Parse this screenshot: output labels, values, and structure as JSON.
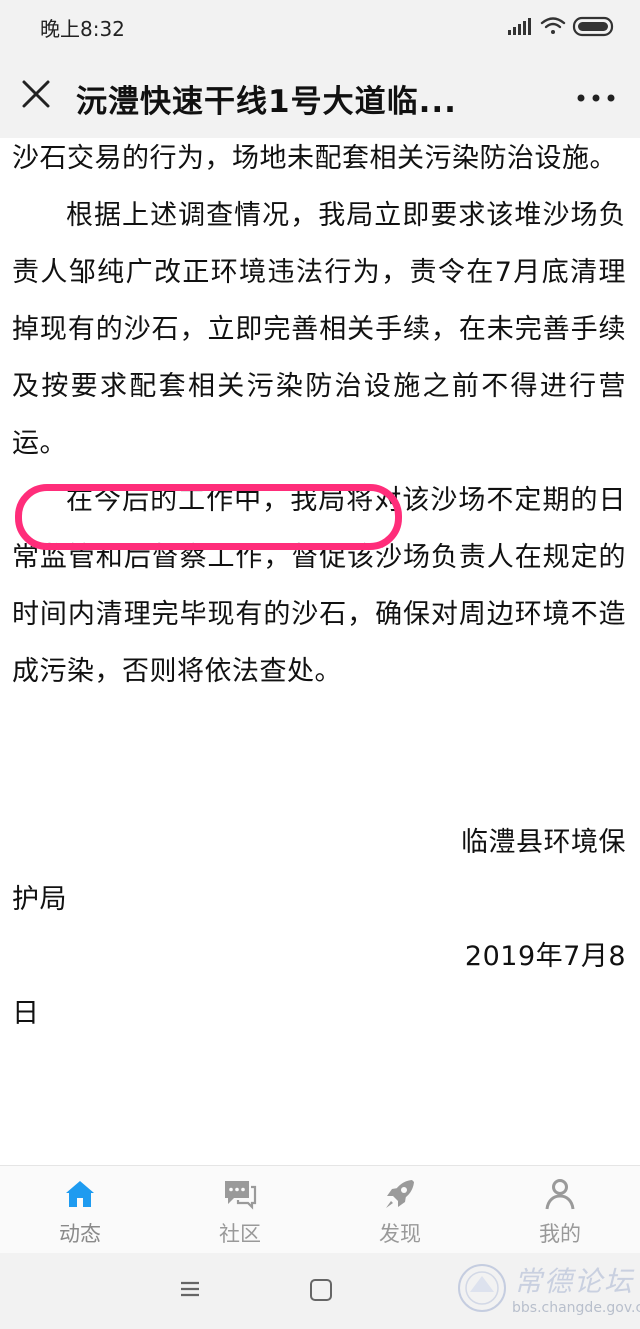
{
  "status_bar": {
    "time": "晚上8:32"
  },
  "nav": {
    "title": "沅澧快速干线1号大道临..."
  },
  "article": {
    "paragraphs": [
      "沙石交易的行为，场地未配套相关污染防治设施。",
      "根据上述调查情况，我局立即要求该堆沙场负责人邹纯广改正环境违法行为，责令在7月底清理掉现有的沙石，立即完善相关手续，在未完善手续及按要求配套相关污染防治设施之前不得进行营运。",
      "在今后的工作中，我局将对该沙场不定期的日常监管和后督察工作，督促该沙场负责人在规定的时间内清理完毕现有的沙石，确保对周边环境不造成污染，否则将依法查处。"
    ],
    "signature_line1": "临澧县环境保",
    "signature_line2": "护局",
    "date_line1": "2019年7月8",
    "date_line2": "日"
  },
  "tabs": [
    {
      "label": "动态",
      "icon": "home-icon",
      "active": true
    },
    {
      "label": "社区",
      "icon": "chat-icon",
      "active": false
    },
    {
      "label": "发现",
      "icon": "rocket-icon",
      "active": false
    },
    {
      "label": "我的",
      "icon": "person-icon",
      "active": false
    }
  ],
  "watermark": {
    "title": "常德论坛",
    "url": "bbs.changde.gov.cn"
  },
  "colors": {
    "accent": "#1e9bf0",
    "highlight": "#ff2d7a",
    "tab_inactive": "#9a9a9a"
  }
}
